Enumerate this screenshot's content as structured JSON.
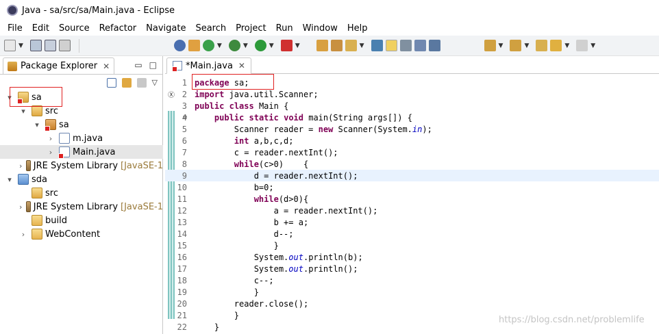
{
  "window": {
    "title": "Java - sa/src/sa/Main.java - Eclipse"
  },
  "menu": [
    "File",
    "Edit",
    "Source",
    "Refactor",
    "Navigate",
    "Search",
    "Project",
    "Run",
    "Window",
    "Help"
  ],
  "explorer": {
    "tab_label": "Package Explorer",
    "tree": [
      {
        "label": "sa",
        "depth": 0,
        "icon": "java-project-icon",
        "twisty": "▾",
        "error": true
      },
      {
        "label": "src",
        "depth": 1,
        "icon": "source-folder-icon",
        "twisty": "▾",
        "error": false
      },
      {
        "label": "sa",
        "depth": 2,
        "icon": "package-icon",
        "twisty": "▾",
        "error": true
      },
      {
        "label": "m.java",
        "depth": 3,
        "icon": "java-file-icon",
        "twisty": "›",
        "error": false
      },
      {
        "label": "Main.java",
        "depth": 3,
        "icon": "java-file-icon",
        "twisty": "›",
        "error": true,
        "selected": true
      },
      {
        "label": "JRE System Library",
        "suffix": "[JavaSE-1",
        "depth": 1,
        "icon": "library-icon",
        "twisty": "›",
        "error": false
      },
      {
        "label": "sda",
        "depth": 0,
        "icon": "web-project-icon",
        "twisty": "▾",
        "error": false
      },
      {
        "label": "src",
        "depth": 1,
        "icon": "source-folder-icon",
        "twisty": "",
        "error": false
      },
      {
        "label": "JRE System Library",
        "suffix": "[JavaSE-1",
        "depth": 1,
        "icon": "library-icon",
        "twisty": "›",
        "error": false
      },
      {
        "label": "build",
        "depth": 1,
        "icon": "folder-icon",
        "twisty": "",
        "error": false
      },
      {
        "label": "WebContent",
        "depth": 1,
        "icon": "folder-icon",
        "twisty": "›",
        "error": false
      }
    ]
  },
  "editor": {
    "tab_label": "*Main.java",
    "current_line": 9,
    "lines": [
      {
        "n": "1",
        "text": "package sa;"
      },
      {
        "n": "2",
        "text": "import java.util.Scanner;",
        "marker": "Ⓧ"
      },
      {
        "n": "3",
        "text": "public class Main {"
      },
      {
        "n": "4",
        "text": "    public static void main(String args[]) {",
        "marker": "⊖"
      },
      {
        "n": "5",
        "text": "        Scanner reader = new Scanner(System.in);"
      },
      {
        "n": "6",
        "text": "        int a,b,c,d;"
      },
      {
        "n": "7",
        "text": "        c = reader.nextInt();"
      },
      {
        "n": "8",
        "text": "        while(c>0)    {"
      },
      {
        "n": "9",
        "text": "            d = reader.nextInt();"
      },
      {
        "n": "10",
        "text": "            b=0;"
      },
      {
        "n": "11",
        "text": "            while(d>0){"
      },
      {
        "n": "12",
        "text": "                a = reader.nextInt();"
      },
      {
        "n": "13",
        "text": "                b += a;"
      },
      {
        "n": "14",
        "text": "                d--;"
      },
      {
        "n": "15",
        "text": "                }"
      },
      {
        "n": "16",
        "text": "            System.out.println(b);"
      },
      {
        "n": "17",
        "text": "            System.out.println();"
      },
      {
        "n": "18",
        "text": "            c--;"
      },
      {
        "n": "19",
        "text": "            }"
      },
      {
        "n": "20",
        "text": "        reader.close();"
      },
      {
        "n": "21",
        "text": "        }"
      },
      {
        "n": "22",
        "text": "    }"
      }
    ]
  },
  "watermark": "https://blog.csdn.net/problemlife",
  "colors": {
    "keyword": "#7f0055",
    "field": "#0000c0",
    "highlight_box": "#e02020",
    "current_line": "#e8f2fe"
  }
}
